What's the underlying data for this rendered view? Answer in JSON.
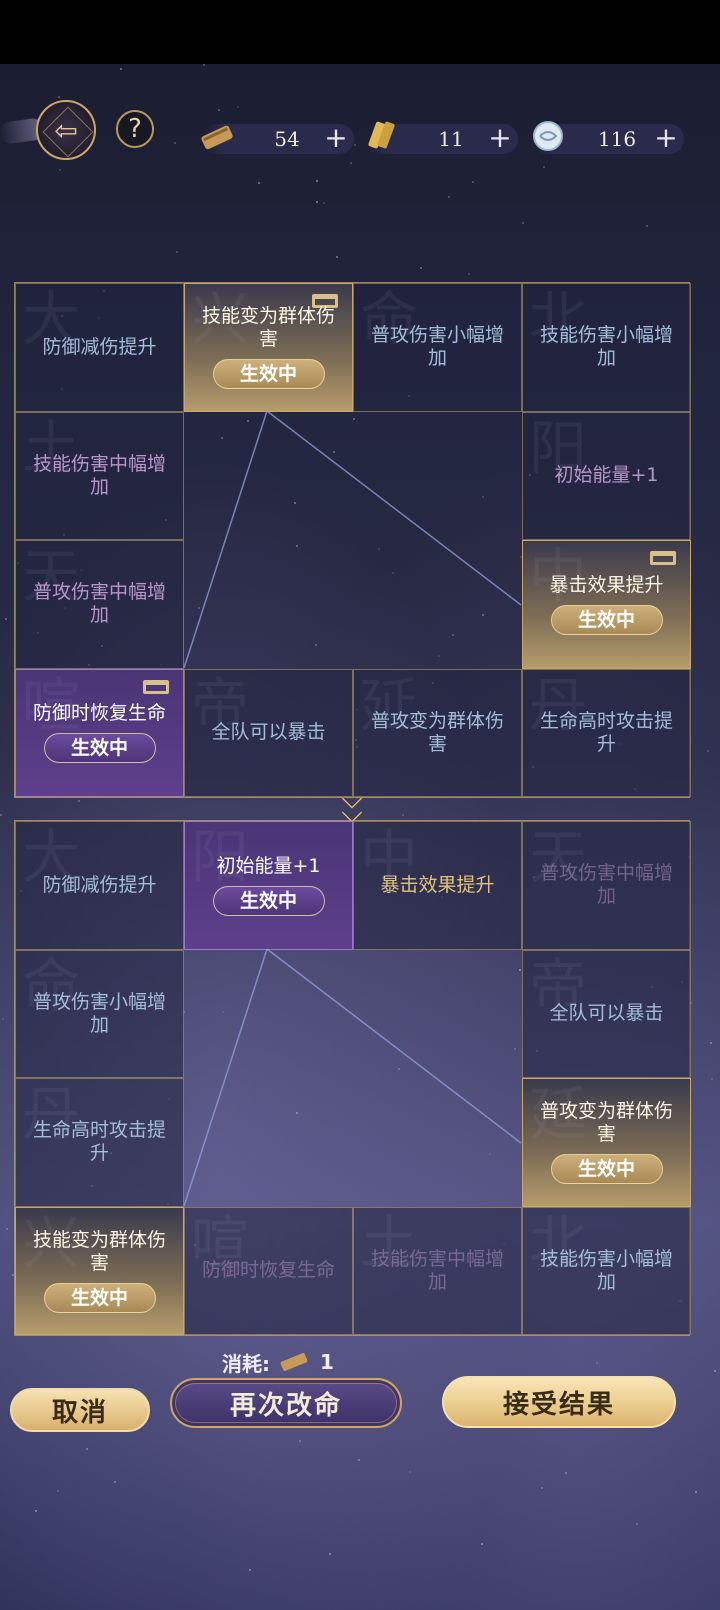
{
  "resources": [
    {
      "icon": "scroll-icon",
      "count": "54"
    },
    {
      "icon": "talisman-icon",
      "count": "11"
    },
    {
      "icon": "orb-icon",
      "count": "116"
    }
  ],
  "help_label": "?",
  "plus_label": "+",
  "active_badge": "生效中",
  "board_top": [
    [
      {
        "label": "防御减伤提升",
        "tone": "blue",
        "glyph": "大"
      },
      {
        "label": "技能变为群体伤害",
        "tone": "gold-active",
        "lock": true,
        "glyph": "兴"
      },
      {
        "label": "普攻伤害小幅增加",
        "tone": "blue",
        "glyph": "命"
      },
      {
        "label": "技能伤害小幅增加",
        "tone": "blue",
        "glyph": "北"
      }
    ],
    [
      {
        "label": "技能伤害中幅增加",
        "tone": "purple",
        "glyph": "土"
      },
      null,
      null,
      {
        "label": "初始能量+1",
        "tone": "purple",
        "glyph": "阳"
      }
    ],
    [
      {
        "label": "普攻伤害中幅增加",
        "tone": "purple",
        "glyph": "天"
      },
      null,
      null,
      {
        "label": "暴击效果提升",
        "tone": "gold-active",
        "lock": true,
        "glyph": "中"
      }
    ],
    [
      {
        "label": "防御时恢复生命",
        "tone": "purple-active",
        "lock": true,
        "glyph": "喧"
      },
      {
        "label": "全队可以暴击",
        "tone": "blue",
        "glyph": "帝"
      },
      {
        "label": "普攻变为群体伤害",
        "tone": "blue",
        "glyph": "延"
      },
      {
        "label": "生命高时攻击提升",
        "tone": "blue",
        "glyph": "丹"
      }
    ]
  ],
  "board_bottom": [
    [
      {
        "label": "防御减伤提升",
        "tone": "blue",
        "glyph": "大"
      },
      {
        "label": "初始能量+1",
        "tone": "purple-active",
        "glyph": "阳"
      },
      {
        "label": "暴击效果提升",
        "tone": "gold",
        "glyph": "中"
      },
      {
        "label": "普攻伤害中幅增加",
        "tone": "dim",
        "glyph": "天"
      }
    ],
    [
      {
        "label": "普攻伤害小幅增加",
        "tone": "blue",
        "glyph": "命"
      },
      null,
      null,
      {
        "label": "全队可以暴击",
        "tone": "blue",
        "glyph": "帝"
      }
    ],
    [
      {
        "label": "生命高时攻击提升",
        "tone": "blue",
        "glyph": "丹"
      },
      null,
      null,
      {
        "label": "普攻变为群体伤害",
        "tone": "gold-active",
        "glyph": "延"
      }
    ],
    [
      {
        "label": "技能变为群体伤害",
        "tone": "gold-active",
        "glyph": "兴"
      },
      {
        "label": "防御时恢复生命",
        "tone": "dim",
        "glyph": "喧"
      },
      {
        "label": "技能伤害中幅增加",
        "tone": "dim",
        "glyph": "土"
      },
      {
        "label": "技能伤害小幅增加",
        "tone": "blue",
        "glyph": "北"
      }
    ]
  ],
  "cost": {
    "label": "消耗:",
    "value": "1"
  },
  "buttons": {
    "cancel": "取消",
    "retry": "再次改命",
    "accept": "接受结果"
  }
}
